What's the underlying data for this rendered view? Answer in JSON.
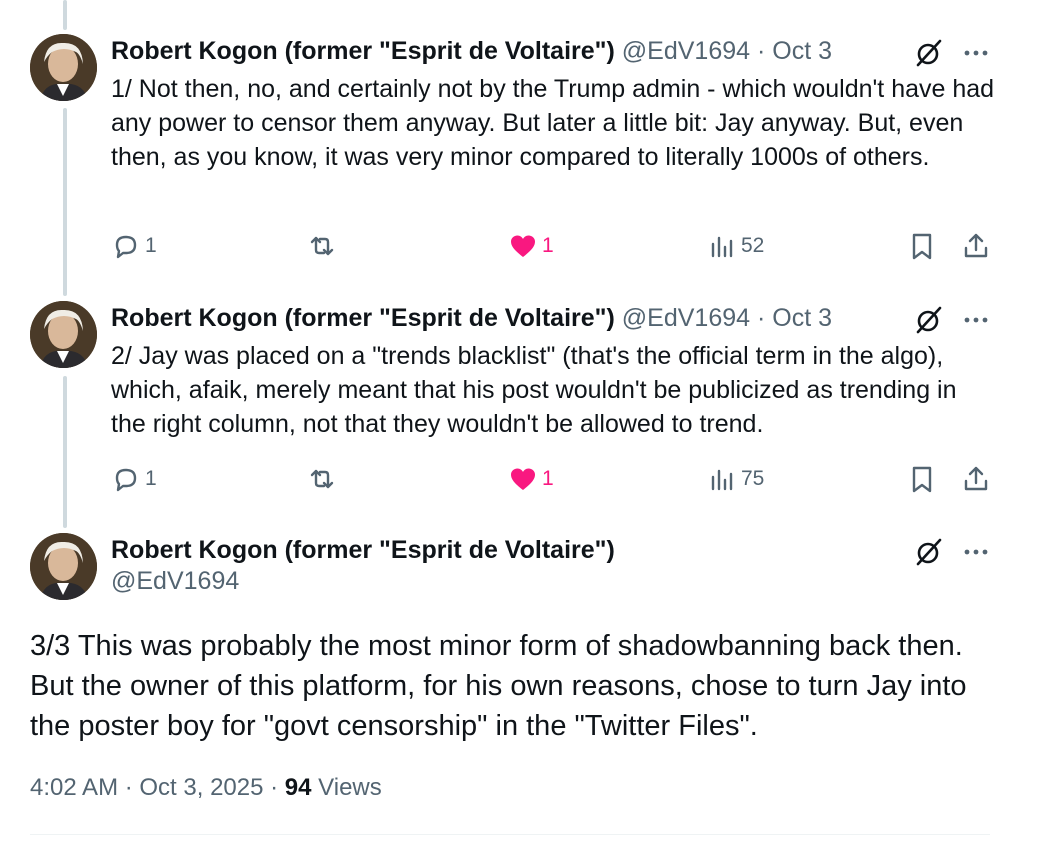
{
  "tweets": [
    {
      "name": "Robert Kogon (former \"Esprit de Voltaire\")",
      "handle": "@EdV1694",
      "date": "· Oct 3",
      "text": "1/ Not then, no, and certainly not by the Trump admin - which wouldn't have had any power to censor them anyway. But later a little bit: Jay anyway. But, even then, as you know, it was very minor compared to literally 1000s of others.",
      "replies": "1",
      "retweets": "",
      "likes": "1",
      "views": "52"
    },
    {
      "name": "Robert Kogon (former \"Esprit de Voltaire\")",
      "handle": "@EdV1694",
      "date": "· Oct 3",
      "text": "2/ Jay was placed on a \"trends blacklist\" (that's the official term in the algo), which, afaik, merely meant that his post wouldn't be publicized as trending in the right column, not that they wouldn't be allowed to trend.",
      "replies": "1",
      "retweets": "",
      "likes": "1",
      "views": "75"
    }
  ],
  "main": {
    "name": "Robert Kogon (former \"Esprit de Voltaire\")",
    "handle": "@EdV1694",
    "text": "3/3 This was probably the most minor form of shadowbanning back then. But the owner of this platform, for his own reasons, chose to turn Jay into the poster boy for \"govt censorship\" in the \"Twitter Files\".",
    "time": "4:02 AM · Oct 3, 2025 · ",
    "views_count": "94",
    "views_label": " Views"
  },
  "colors": {
    "text": "#0f1419",
    "muted": "#536471",
    "like": "#f91880",
    "thread_line": "#cfd9de"
  },
  "icons": [
    "reply-icon",
    "retweet-icon",
    "like-icon",
    "views-icon",
    "bookmark-icon",
    "share-icon",
    "grok-icon",
    "more-icon"
  ]
}
